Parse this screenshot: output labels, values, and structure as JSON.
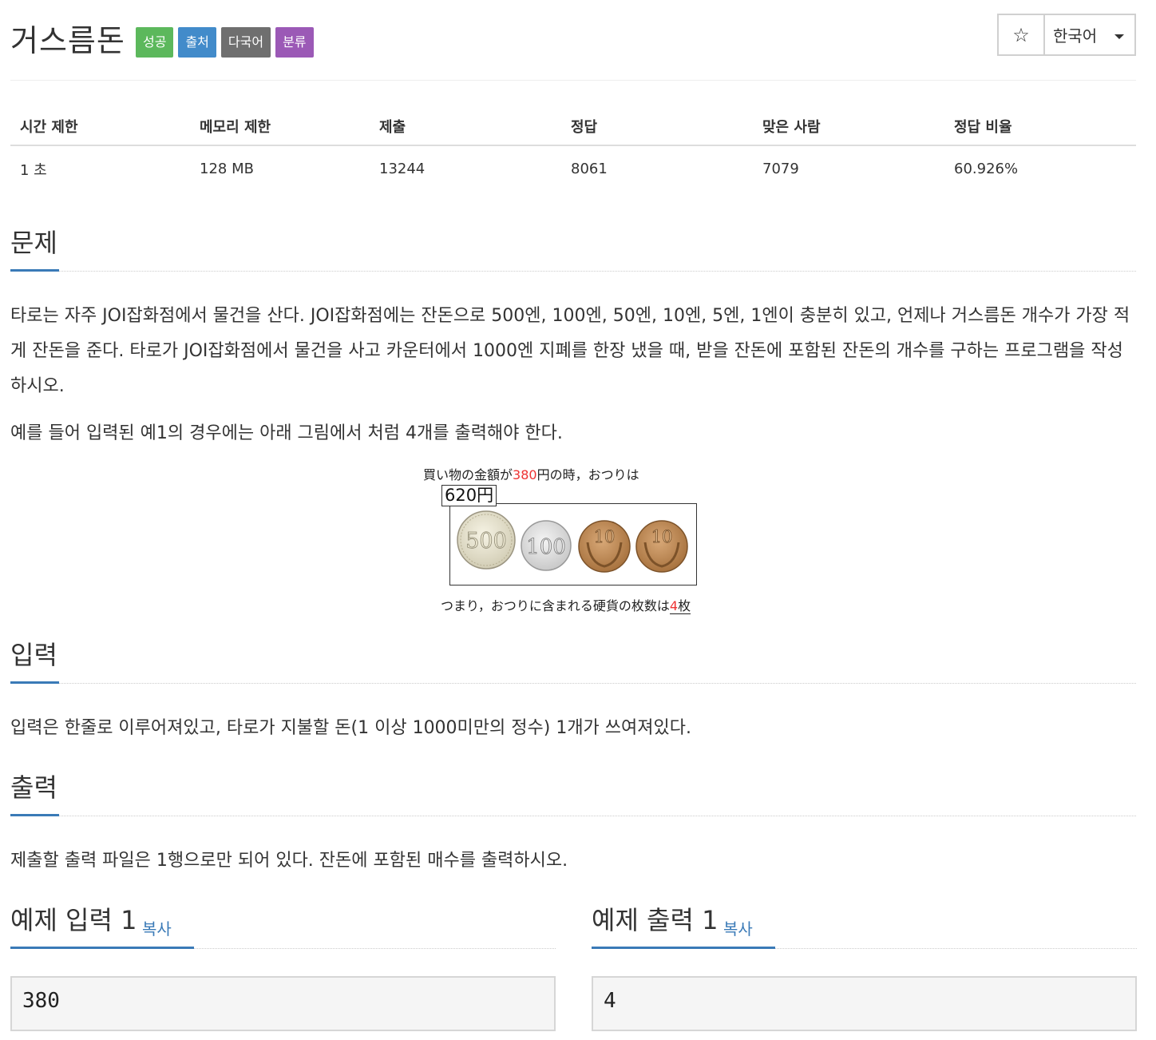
{
  "header": {
    "title": "거스름돈",
    "badges": [
      "성공",
      "출처",
      "다국어",
      "분류"
    ],
    "star_label": "☆",
    "language": "한국어"
  },
  "stats": {
    "headers": [
      "시간 제한",
      "메모리 제한",
      "제출",
      "정답",
      "맞은 사람",
      "정답 비율"
    ],
    "values": [
      "1 초",
      "128 MB",
      "13244",
      "8061",
      "7079",
      "60.926%"
    ]
  },
  "problem": {
    "heading": "문제",
    "paragraph1": "타로는 자주 JOI잡화점에서 물건을 산다. JOI잡화점에는 잔돈으로 500엔, 100엔, 50엔, 10엔, 5엔, 1엔이 충분히 있고, 언제나 거스름돈 개수가 가장 적게 잔돈을 준다. 타로가 JOI잡화점에서 물건을 사고 카운터에서 1000엔 지폐를 한장 냈을 때, 받을 잔돈에 포함된 잔돈의 개수를 구하는 프로그램을 작성하시오.",
    "paragraph2": "예를 들어 입력된 예1의 경우에는 아래 그림에서 처럼 4개를 출력해야 한다."
  },
  "figure": {
    "caption_top_pre": "買い物の金額が",
    "caption_top_amount": "380",
    "caption_top_post": "円の時，おつりは",
    "price_tag": "620円",
    "coins": [
      "500",
      "100",
      "10",
      "10"
    ],
    "caption_bottom_pre": "つまり，おつりに含まれる硬貨の枚数は",
    "caption_bottom_count": "4",
    "caption_bottom_unit": "枚"
  },
  "input_section": {
    "heading": "입력",
    "text": "입력은 한줄로 이루어져있고, 타로가 지불할 돈(1 이상 1000미만의 정수) 1개가 쓰여져있다."
  },
  "output_section": {
    "heading": "출력",
    "text": "제출할 출력 파일은 1행으로만 되어 있다. 잔돈에 포함된 매수를 출력하시오."
  },
  "samples": {
    "input_heading": "예제 입력 1",
    "output_heading": "예제 출력 1",
    "copy_label": "복사",
    "input_value": "380",
    "output_value": "4"
  },
  "colors": {
    "badge_success": "#5cb85c",
    "badge_source": "#428bca",
    "badge_multilang": "#6f6f6f",
    "badge_category": "#9b59b6",
    "accent": "#3a7ab7"
  }
}
